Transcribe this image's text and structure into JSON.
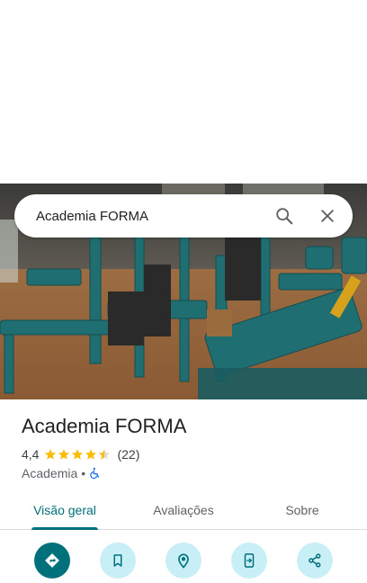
{
  "search": {
    "query": "Academia FORMA"
  },
  "place": {
    "name": "Academia FORMA",
    "rating": "4,4",
    "rating_value": 4.4,
    "review_count": "(22)",
    "category": "Academia",
    "separator": "•",
    "accessibility_icon": "wheelchair-icon"
  },
  "tabs": [
    {
      "label": "Visão geral",
      "active": true
    },
    {
      "label": "Avaliações",
      "active": false
    },
    {
      "label": "Sobre",
      "active": false
    }
  ],
  "actions": [
    {
      "icon": "directions-icon"
    },
    {
      "icon": "bookmark-icon"
    },
    {
      "icon": "location-pin-icon"
    },
    {
      "icon": "send-to-phone-icon"
    },
    {
      "icon": "share-icon"
    }
  ],
  "colors": {
    "accent": "#00707a",
    "action_bg": "#c9eff6",
    "star": "#fbbc04",
    "accessibility": "#1a73e8"
  }
}
